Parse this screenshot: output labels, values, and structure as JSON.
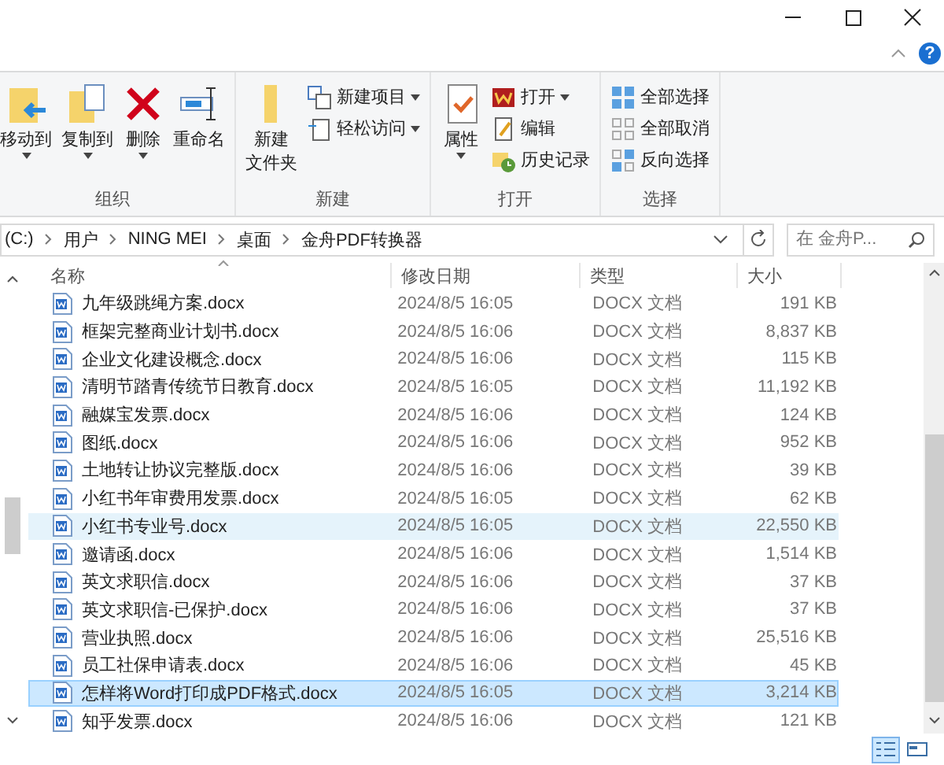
{
  "window": {
    "help": "?"
  },
  "ribbon": {
    "groups": [
      {
        "label": "组织",
        "items": [
          {
            "kind": "big",
            "lines": [
              "移动到"
            ],
            "dropdown": true
          },
          {
            "kind": "big",
            "lines": [
              "复制到"
            ],
            "dropdown": true
          },
          {
            "kind": "big",
            "lines": [
              "删除"
            ],
            "dropdown": true
          },
          {
            "kind": "big",
            "lines": [
              "重命名"
            ],
            "dropdown": false
          }
        ]
      },
      {
        "label": "新建",
        "items": [
          {
            "kind": "big",
            "lines": [
              "新建",
              "文件夹"
            ],
            "dropdown": false
          },
          {
            "kind": "small",
            "lines": [
              "新建项目"
            ],
            "dropdown": true
          },
          {
            "kind": "small",
            "lines": [
              "轻松访问"
            ],
            "dropdown": true
          }
        ]
      },
      {
        "label": "打开",
        "items": [
          {
            "kind": "big",
            "lines": [
              "属性"
            ],
            "dropdown": true
          },
          {
            "kind": "small",
            "lines": [
              "打开"
            ],
            "dropdown": true
          },
          {
            "kind": "small",
            "lines": [
              "编辑"
            ],
            "dropdown": false
          },
          {
            "kind": "small",
            "lines": [
              "历史记录"
            ],
            "dropdown": false
          }
        ]
      },
      {
        "label": "选择",
        "items": [
          {
            "kind": "small",
            "lines": [
              "全部选择"
            ],
            "dropdown": false
          },
          {
            "kind": "small",
            "lines": [
              "全部取消"
            ],
            "dropdown": false
          },
          {
            "kind": "small",
            "lines": [
              "反向选择"
            ],
            "dropdown": false
          }
        ]
      }
    ]
  },
  "address": {
    "crumbs": [
      "(C:)",
      "用户",
      "NING MEI",
      "桌面",
      "金舟PDF转换器"
    ]
  },
  "search": {
    "placeholder": "在 金舟P..."
  },
  "table": {
    "columns": [
      "名称",
      "修改日期",
      "类型",
      "大小"
    ],
    "rows": [
      {
        "name": "九年级跳绳方案.docx",
        "date": "2024/8/5 16:05",
        "type": "DOCX 文档",
        "size": "191 KB",
        "selected": false,
        "hovered": false
      },
      {
        "name": "框架完整商业计划书.docx",
        "date": "2024/8/5 16:06",
        "type": "DOCX 文档",
        "size": "8,837 KB",
        "selected": false,
        "hovered": false
      },
      {
        "name": "企业文化建设概念.docx",
        "date": "2024/8/5 16:06",
        "type": "DOCX 文档",
        "size": "115 KB",
        "selected": false,
        "hovered": false
      },
      {
        "name": "清明节踏青传统节日教育.docx",
        "date": "2024/8/5 16:05",
        "type": "DOCX 文档",
        "size": "11,192 KB",
        "selected": false,
        "hovered": false
      },
      {
        "name": "融媒宝发票.docx",
        "date": "2024/8/5 16:06",
        "type": "DOCX 文档",
        "size": "124 KB",
        "selected": false,
        "hovered": false
      },
      {
        "name": "图纸.docx",
        "date": "2024/8/5 16:06",
        "type": "DOCX 文档",
        "size": "952 KB",
        "selected": false,
        "hovered": false
      },
      {
        "name": "土地转让协议完整版.docx",
        "date": "2024/8/5 16:06",
        "type": "DOCX 文档",
        "size": "39 KB",
        "selected": false,
        "hovered": false
      },
      {
        "name": "小红书年审费用发票.docx",
        "date": "2024/8/5 16:05",
        "type": "DOCX 文档",
        "size": "62 KB",
        "selected": false,
        "hovered": false
      },
      {
        "name": "小红书专业号.docx",
        "date": "2024/8/5 16:05",
        "type": "DOCX 文档",
        "size": "22,550 KB",
        "selected": false,
        "hovered": true
      },
      {
        "name": "邀请函.docx",
        "date": "2024/8/5 16:06",
        "type": "DOCX 文档",
        "size": "1,514 KB",
        "selected": false,
        "hovered": false
      },
      {
        "name": "英文求职信.docx",
        "date": "2024/8/5 16:06",
        "type": "DOCX 文档",
        "size": "37 KB",
        "selected": false,
        "hovered": false
      },
      {
        "name": "英文求职信-已保护.docx",
        "date": "2024/8/5 16:06",
        "type": "DOCX 文档",
        "size": "37 KB",
        "selected": false,
        "hovered": false
      },
      {
        "name": "营业执照.docx",
        "date": "2024/8/5 16:06",
        "type": "DOCX 文档",
        "size": "25,516 KB",
        "selected": false,
        "hovered": false
      },
      {
        "name": "员工社保申请表.docx",
        "date": "2024/8/5 16:06",
        "type": "DOCX 文档",
        "size": "45 KB",
        "selected": false,
        "hovered": false
      },
      {
        "name": "怎样将Word打印成PDF格式.docx",
        "date": "2024/8/5 16:05",
        "type": "DOCX 文档",
        "size": "3,214 KB",
        "selected": true,
        "hovered": false
      },
      {
        "name": "知乎发票.docx",
        "date": "2024/8/5 16:06",
        "type": "DOCX 文档",
        "size": "121 KB",
        "selected": false,
        "hovered": false
      }
    ]
  },
  "views": [
    {
      "kind": "details",
      "selected": true
    },
    {
      "kind": "tiles",
      "selected": false
    }
  ]
}
